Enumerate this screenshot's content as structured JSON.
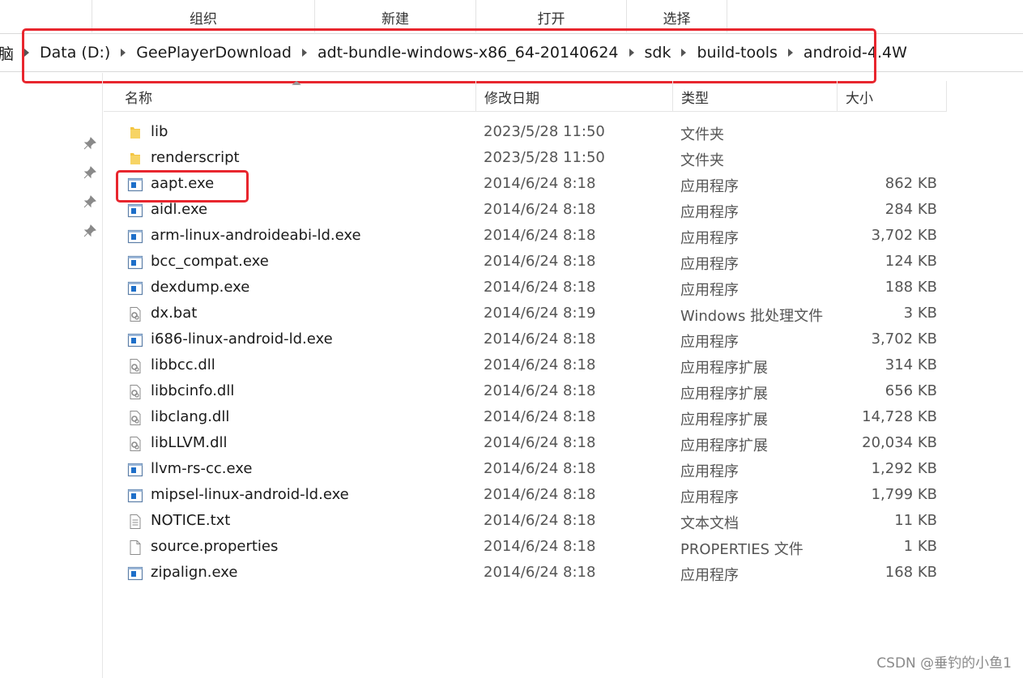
{
  "ribbon": {
    "groups": [
      "组织",
      "新建",
      "打开",
      "选择"
    ]
  },
  "address": {
    "partial": "脑",
    "crumbs": [
      "Data (D:)",
      "GeePlayerDownload",
      "adt-bundle-windows-x86_64-20140624",
      "sdk",
      "build-tools",
      "android-4.4W"
    ]
  },
  "columns": {
    "name": "名称",
    "date": "修改日期",
    "type": "类型",
    "size": "大小"
  },
  "files": [
    {
      "name": "lib",
      "date": "2023/5/28 11:50",
      "type": "文件夹",
      "size": "",
      "icon": "folder-icon"
    },
    {
      "name": "renderscript",
      "date": "2023/5/28 11:50",
      "type": "文件夹",
      "size": "",
      "icon": "folder-icon"
    },
    {
      "name": "aapt.exe",
      "date": "2014/6/24 8:18",
      "type": "应用程序",
      "size": "862 KB",
      "icon": "exe-icon"
    },
    {
      "name": "aidl.exe",
      "date": "2014/6/24 8:18",
      "type": "应用程序",
      "size": "284 KB",
      "icon": "exe-icon"
    },
    {
      "name": "arm-linux-androideabi-ld.exe",
      "date": "2014/6/24 8:18",
      "type": "应用程序",
      "size": "3,702 KB",
      "icon": "exe-icon"
    },
    {
      "name": "bcc_compat.exe",
      "date": "2014/6/24 8:18",
      "type": "应用程序",
      "size": "124 KB",
      "icon": "exe-icon"
    },
    {
      "name": "dexdump.exe",
      "date": "2014/6/24 8:18",
      "type": "应用程序",
      "size": "188 KB",
      "icon": "exe-icon"
    },
    {
      "name": "dx.bat",
      "date": "2014/6/24 8:19",
      "type": "Windows 批处理文件",
      "size": "3 KB",
      "icon": "gear-file-icon"
    },
    {
      "name": "i686-linux-android-ld.exe",
      "date": "2014/6/24 8:18",
      "type": "应用程序",
      "size": "3,702 KB",
      "icon": "exe-icon"
    },
    {
      "name": "libbcc.dll",
      "date": "2014/6/24 8:18",
      "type": "应用程序扩展",
      "size": "314 KB",
      "icon": "gear-file-icon"
    },
    {
      "name": "libbcinfo.dll",
      "date": "2014/6/24 8:18",
      "type": "应用程序扩展",
      "size": "656 KB",
      "icon": "gear-file-icon"
    },
    {
      "name": "libclang.dll",
      "date": "2014/6/24 8:18",
      "type": "应用程序扩展",
      "size": "14,728 KB",
      "icon": "gear-file-icon"
    },
    {
      "name": "libLLVM.dll",
      "date": "2014/6/24 8:18",
      "type": "应用程序扩展",
      "size": "20,034 KB",
      "icon": "gear-file-icon"
    },
    {
      "name": "llvm-rs-cc.exe",
      "date": "2014/6/24 8:18",
      "type": "应用程序",
      "size": "1,292 KB",
      "icon": "exe-icon"
    },
    {
      "name": "mipsel-linux-android-ld.exe",
      "date": "2014/6/24 8:18",
      "type": "应用程序",
      "size": "1,799 KB",
      "icon": "exe-icon"
    },
    {
      "name": "NOTICE.txt",
      "date": "2014/6/24 8:18",
      "type": "文本文档",
      "size": "11 KB",
      "icon": "text-file-icon"
    },
    {
      "name": "source.properties",
      "date": "2014/6/24 8:18",
      "type": "PROPERTIES 文件",
      "size": "1 KB",
      "icon": "blank-file-icon"
    },
    {
      "name": "zipalign.exe",
      "date": "2014/6/24 8:18",
      "type": "应用程序",
      "size": "168 KB",
      "icon": "exe-icon"
    }
  ],
  "watermark": "CSDN @垂钓的小鱼1",
  "colors": {
    "highlight": "#e8262e",
    "folder": "#f4c542",
    "exe_blue": "#1e6fc9"
  }
}
